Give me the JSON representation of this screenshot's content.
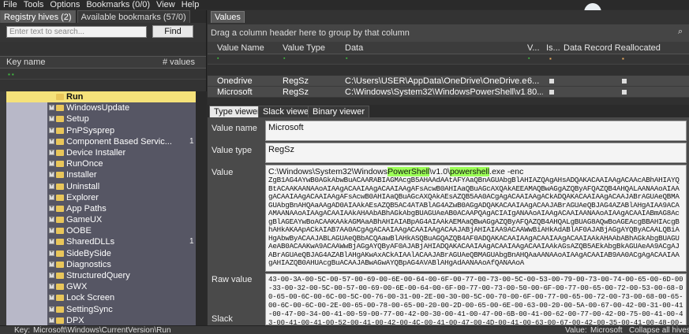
{
  "menu": [
    "File",
    "Tools",
    "Options",
    "Bookmarks (0/0)",
    "View",
    "Help"
  ],
  "left_tabs": [
    "Registry hives (2)",
    "Available bookmarks (57/0)"
  ],
  "search": {
    "placeholder": "Enter text to search...",
    "find_label": "Find"
  },
  "tree_header": {
    "key_name": "Key name",
    "values": "# values"
  },
  "tree_items": [
    {
      "label": "Run",
      "count": "",
      "selected": true
    },
    {
      "label": "WindowsUpdate",
      "count": ""
    },
    {
      "label": "Setup",
      "count": ""
    },
    {
      "label": "PnPSysprep",
      "count": ""
    },
    {
      "label": "Component Based Servic...",
      "count": "1"
    },
    {
      "label": "Device Installer",
      "count": ""
    },
    {
      "label": "RunOnce",
      "count": ""
    },
    {
      "label": "Installer",
      "count": ""
    },
    {
      "label": "Uninstall",
      "count": ""
    },
    {
      "label": "Explorer",
      "count": ""
    },
    {
      "label": "App Paths",
      "count": ""
    },
    {
      "label": "GameUX",
      "count": ""
    },
    {
      "label": "OOBE",
      "count": ""
    },
    {
      "label": "SharedDLLs",
      "count": "1"
    },
    {
      "label": "SideBySide",
      "count": ""
    },
    {
      "label": "Diagnostics",
      "count": ""
    },
    {
      "label": "StructuredQuery",
      "count": ""
    },
    {
      "label": "GWX",
      "count": ""
    },
    {
      "label": "Lock Screen",
      "count": ""
    },
    {
      "label": "SettingSync",
      "count": ""
    },
    {
      "label": "DPX",
      "count": ""
    }
  ],
  "right_tab": "Values",
  "group_hint": "Drag a column header here to group by that column",
  "grid_headers": [
    "Value Name",
    "Value Type",
    "Data",
    "V...",
    "Is...",
    "Data Record Reallocated"
  ],
  "grid_rows": [
    {
      "name": "Onedrive",
      "type": "RegSz",
      "data": "C:\\Users\\USER\\AppData\\OneDrive\\OneDrive.exe",
      "v": "6..."
    },
    {
      "name": "Microsoft",
      "type": "RegSz",
      "data": "C:\\Windows\\System32\\WindowsPowerShell\\v1.0\\...",
      "v": "80..."
    }
  ],
  "viewer_tabs": [
    "Type viewer",
    "Slack viewer",
    "Binary viewer"
  ],
  "detail": {
    "value_name_label": "Value name",
    "value_name": "Microsoft",
    "value_type_label": "Value type",
    "value_type": "RegSz",
    "value_label": "Value",
    "value_prefix": "C:\\Windows\\System32\\Windows",
    "value_hl1": "PowerShell",
    "value_mid": "\\v1.0\\",
    "value_hl2": "powershell",
    "value_suffix": ".exe -enc",
    "value_b64": "ZgB1AG4AYwB0AGkAbwBuACAARABIAGMAcgB5AHAAdAAtAFYAaQBnAGUAbgBlAHIAZQAgAHsADQAKACAAIAAgACAAcABhAHIAYQBtACAAKAANAAoAIAAgACAAIAAgACAAIAAgAFsAcwB0AHIAaQBuAGcAXQAkAEEAMAQBwAGgAZQByAFQAZQB4AHQALAANAAoAIAAgACAAIAAgACAAIAAgAFsAcwB0AHIAaQBuAGcAXQAkAEsAZQB5AA0ACgAgACAAIAAgACkADQAKACAAIAAgACAAJABrAGUAeQBMAGUAbgBnAHQAaAAgAD0AIAAkAEsAZQB5AC4ATABlAG4AZwB0AGgADQAKACAAIAAgACAAJABrAGUAeQBJAG4AZABlAHgAIAA9ACAAMAANAAoAIAAgACAAIAAkAHAAbABhAGkAbgBUAGUAeAB0ACAAPQAgACIAIgANAAoAIAAgACAAIAANAAoAIAAgACAAIABmAG8AcgBlAGEAYwBoACAAKAAkAGMAaABhAHIAIABpAG4AIAAkAEMAaQBwAGgAZQByAFQAZQB4AHQALgBUAG8AQwBoAGEAcgBBAHIAcgBhAHkAKAApACkAIAB7AA0ACgAgACAAIAAgACAAIAAgACAAJABjAHIAIAA9ACAAWwBiAHkAdABlAF0AJABjAGgAYQByACAALQBiAHgAbwByACAAJABLAGUAeQBbACQAawBlAHkASQBuAGQAZQB4AF0ADQAKACAAIAAgACAAIAAgACAAIAAkAHAAbABhAGkAbgBUAGUAeAB0ACAAKwA9ACAAWwBjAGgAYQByAF0AJABjAHIADQAKACAAIAAgACAAIAAgACAAIAAkAGsAZQB5AEkAbgBkAGUAeAA9ACgAJABrAGUAeQBJAG4AZABlAHgAKwAxACkAIAAlACAAJABrAGUAeQBMAGUAbgBnAHQAaAANAAoAIAAgACAAIAB9AA0ACgAgACAAIAAgAHIAZQB0AHUAcgBuACAAJABwAGwAYQBpAG4AVABlAHgAdAANAAoAfQANAAoA",
    "raw_label": "Raw value",
    "raw_hex": "43-00-3A-00-5C-00-57-00-69-00-6E-00-64-00-6F-00-77-00-73-00-5C-00-53-00-79-00-73-00-74-00-65-00-6D-00-33-00-32-00-5C-00-57-00-69-00-6E-00-64-00-6F-00-77-00-73-00-50-00-6F-00-77-00-65-00-72-00-53-00-68-00-65-00-6C-00-6C-00-5C-00-76-00-31-00-2E-00-30-00-5C-00-70-00-6F-00-77-00-65-00-72-00-73-00-68-00-65-00-6C-00-6C-00-2E-00-65-00-78-00-65-00-20-00-2D-00-65-00-6E-00-63-00-20-00-5A-00-67-00-42-00-31-00-41-00-47-00-34-00-41-00-59-00-77-00-42-00-30-00-41-00-47-00-6B-00-41-00-62-00-77-00-42-00-75-00-41-00-43-00-41-00-41-00-52-00-41-00-42-00-4C-00-41-00-47-00-4D-00-41-00-63-00-67-00-42-00-35-00-41-00-48-00-41-00-41-00-64-00-41-00-41-00-74-00-41-00-46-00",
    "slack_label": "Slack"
  },
  "status": {
    "key_label": "Key:",
    "key_path": "Microsoft\\Windows\\CurrentVersion\\Run",
    "value_label": "Value:",
    "value": "Microsoft",
    "collapse": "Collapse all hives"
  }
}
